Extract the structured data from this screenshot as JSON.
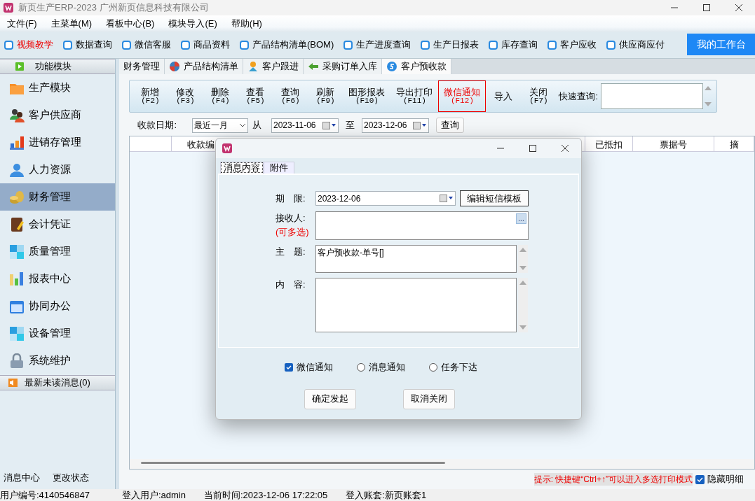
{
  "window": {
    "title": "新页生产ERP-2023 广州新页信息科技有限公司"
  },
  "menu": [
    "文件(F)",
    "主菜单(M)",
    "看板中心(B)",
    "模块导入(E)",
    "帮助(H)"
  ],
  "quick_links": [
    {
      "label": "视频教学",
      "highlight": true
    },
    {
      "label": "数据查询",
      "highlight": false
    },
    {
      "label": "微信客服",
      "highlight": false
    },
    {
      "label": "商品资料",
      "highlight": false
    },
    {
      "label": "产品结构清单(BOM)",
      "highlight": false
    },
    {
      "label": "生产进度查询",
      "highlight": false
    },
    {
      "label": "生产日报表",
      "highlight": false
    },
    {
      "label": "库存查询",
      "highlight": false
    },
    {
      "label": "客户应收",
      "highlight": false
    },
    {
      "label": "供应商应付",
      "highlight": false
    }
  ],
  "workbench_button": "我的工作台",
  "sidebar": {
    "header": "功能模块",
    "items": [
      {
        "label": "生产模块",
        "selected": false
      },
      {
        "label": "客户供应商",
        "selected": false
      },
      {
        "label": "进销存管理",
        "selected": false
      },
      {
        "label": "人力资源",
        "selected": false
      },
      {
        "label": "财务管理",
        "selected": true
      },
      {
        "label": "会计凭证",
        "selected": false
      },
      {
        "label": "质量管理",
        "selected": false
      },
      {
        "label": "报表中心",
        "selected": false
      },
      {
        "label": "协同办公",
        "selected": false
      },
      {
        "label": "设备管理",
        "selected": false
      },
      {
        "label": "系统维护",
        "selected": false
      }
    ],
    "messages_header": "最新未读消息(0)",
    "footer_links": [
      "消息中心",
      "更改状态"
    ]
  },
  "doc_tabs": [
    {
      "label": "财务管理",
      "selected": false
    },
    {
      "label": "产品结构清单",
      "selected": false
    },
    {
      "label": "客户跟进",
      "selected": false
    },
    {
      "label": "采购订单入库",
      "selected": false
    },
    {
      "label": "客户预收款",
      "selected": true
    }
  ],
  "toolbar": {
    "buttons": [
      {
        "label": "新增",
        "key": "(F2)",
        "highlighted": false
      },
      {
        "label": "修改",
        "key": "(F3)",
        "highlighted": false
      },
      {
        "label": "删除",
        "key": "(F4)",
        "highlighted": false
      },
      {
        "label": "查看",
        "key": "(F5)",
        "highlighted": false
      },
      {
        "label": "查询",
        "key": "(F6)",
        "highlighted": false
      },
      {
        "label": "刷新",
        "key": "(F9)",
        "highlighted": false
      },
      {
        "label": "图形报表",
        "key": "(F10)",
        "highlighted": false
      },
      {
        "label": "导出打印",
        "key": "(F11)",
        "highlighted": false
      },
      {
        "label": "微信通知",
        "key": "(F12)",
        "highlighted": true
      },
      {
        "label": "导入",
        "highlighted": false
      },
      {
        "label": "关闭",
        "key": "(F7)",
        "highlighted": false
      }
    ],
    "quick_search_label": "快速查询:"
  },
  "filter": {
    "label": "收款日期:",
    "range": "最近一月",
    "from_label": "从",
    "from": "2023-11-06",
    "to_label": "至",
    "to": "2023-12-06",
    "query_button": "查询"
  },
  "table": {
    "columns": [
      "收款编",
      "已抵扣",
      "票据号",
      "摘"
    ]
  },
  "hint": "提示: 快捷键“Ctrl+↑”可以进入多选打印模式",
  "hide_details": {
    "label": "隐藏明细",
    "checked": true
  },
  "status_bar": [
    "用户编号:4140546847",
    "登入用户:admin",
    "当前时间:2023-12-06 17:22:05",
    "登入账套:新页账套1"
  ],
  "dialog": {
    "tabs": [
      {
        "label": "消息内容",
        "selected": true
      },
      {
        "label": "附件",
        "selected": false
      }
    ],
    "deadline_label": "期　限:",
    "deadline": "2023-12-06",
    "template_button": "编辑短信模板",
    "recipient_label": "接收人:",
    "recipient_note": "(可多选)",
    "picker_button": "...",
    "subject_label": "主　题:",
    "subject": "客户预收款-单号[]",
    "content_label": "内　容:",
    "options": [
      {
        "label": "微信通知",
        "checked": true,
        "kind": "checkbox"
      },
      {
        "label": "消息通知",
        "checked": false,
        "kind": "radio"
      },
      {
        "label": "任务下达",
        "checked": false,
        "kind": "radio"
      }
    ],
    "buttons": [
      "确定发起",
      "取消关闭"
    ]
  }
}
